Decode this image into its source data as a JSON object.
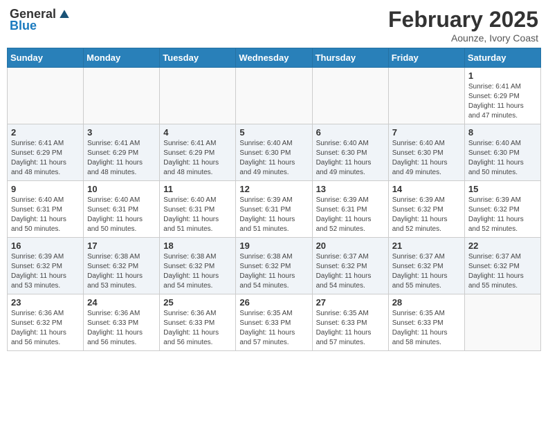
{
  "header": {
    "logo": {
      "general": "General",
      "blue": "Blue"
    },
    "title": "February 2025",
    "location": "Aounze, Ivory Coast"
  },
  "days_of_week": [
    "Sunday",
    "Monday",
    "Tuesday",
    "Wednesday",
    "Thursday",
    "Friday",
    "Saturday"
  ],
  "weeks": [
    {
      "days": [
        {
          "num": "",
          "info": ""
        },
        {
          "num": "",
          "info": ""
        },
        {
          "num": "",
          "info": ""
        },
        {
          "num": "",
          "info": ""
        },
        {
          "num": "",
          "info": ""
        },
        {
          "num": "",
          "info": ""
        },
        {
          "num": "1",
          "info": "Sunrise: 6:41 AM\nSunset: 6:29 PM\nDaylight: 11 hours and 47 minutes."
        }
      ]
    },
    {
      "days": [
        {
          "num": "2",
          "info": "Sunrise: 6:41 AM\nSunset: 6:29 PM\nDaylight: 11 hours and 48 minutes."
        },
        {
          "num": "3",
          "info": "Sunrise: 6:41 AM\nSunset: 6:29 PM\nDaylight: 11 hours and 48 minutes."
        },
        {
          "num": "4",
          "info": "Sunrise: 6:41 AM\nSunset: 6:29 PM\nDaylight: 11 hours and 48 minutes."
        },
        {
          "num": "5",
          "info": "Sunrise: 6:40 AM\nSunset: 6:30 PM\nDaylight: 11 hours and 49 minutes."
        },
        {
          "num": "6",
          "info": "Sunrise: 6:40 AM\nSunset: 6:30 PM\nDaylight: 11 hours and 49 minutes."
        },
        {
          "num": "7",
          "info": "Sunrise: 6:40 AM\nSunset: 6:30 PM\nDaylight: 11 hours and 49 minutes."
        },
        {
          "num": "8",
          "info": "Sunrise: 6:40 AM\nSunset: 6:30 PM\nDaylight: 11 hours and 50 minutes."
        }
      ]
    },
    {
      "days": [
        {
          "num": "9",
          "info": "Sunrise: 6:40 AM\nSunset: 6:31 PM\nDaylight: 11 hours and 50 minutes."
        },
        {
          "num": "10",
          "info": "Sunrise: 6:40 AM\nSunset: 6:31 PM\nDaylight: 11 hours and 50 minutes."
        },
        {
          "num": "11",
          "info": "Sunrise: 6:40 AM\nSunset: 6:31 PM\nDaylight: 11 hours and 51 minutes."
        },
        {
          "num": "12",
          "info": "Sunrise: 6:39 AM\nSunset: 6:31 PM\nDaylight: 11 hours and 51 minutes."
        },
        {
          "num": "13",
          "info": "Sunrise: 6:39 AM\nSunset: 6:31 PM\nDaylight: 11 hours and 52 minutes."
        },
        {
          "num": "14",
          "info": "Sunrise: 6:39 AM\nSunset: 6:32 PM\nDaylight: 11 hours and 52 minutes."
        },
        {
          "num": "15",
          "info": "Sunrise: 6:39 AM\nSunset: 6:32 PM\nDaylight: 11 hours and 52 minutes."
        }
      ]
    },
    {
      "days": [
        {
          "num": "16",
          "info": "Sunrise: 6:39 AM\nSunset: 6:32 PM\nDaylight: 11 hours and 53 minutes."
        },
        {
          "num": "17",
          "info": "Sunrise: 6:38 AM\nSunset: 6:32 PM\nDaylight: 11 hours and 53 minutes."
        },
        {
          "num": "18",
          "info": "Sunrise: 6:38 AM\nSunset: 6:32 PM\nDaylight: 11 hours and 54 minutes."
        },
        {
          "num": "19",
          "info": "Sunrise: 6:38 AM\nSunset: 6:32 PM\nDaylight: 11 hours and 54 minutes."
        },
        {
          "num": "20",
          "info": "Sunrise: 6:37 AM\nSunset: 6:32 PM\nDaylight: 11 hours and 54 minutes."
        },
        {
          "num": "21",
          "info": "Sunrise: 6:37 AM\nSunset: 6:32 PM\nDaylight: 11 hours and 55 minutes."
        },
        {
          "num": "22",
          "info": "Sunrise: 6:37 AM\nSunset: 6:32 PM\nDaylight: 11 hours and 55 minutes."
        }
      ]
    },
    {
      "days": [
        {
          "num": "23",
          "info": "Sunrise: 6:36 AM\nSunset: 6:32 PM\nDaylight: 11 hours and 56 minutes."
        },
        {
          "num": "24",
          "info": "Sunrise: 6:36 AM\nSunset: 6:33 PM\nDaylight: 11 hours and 56 minutes."
        },
        {
          "num": "25",
          "info": "Sunrise: 6:36 AM\nSunset: 6:33 PM\nDaylight: 11 hours and 56 minutes."
        },
        {
          "num": "26",
          "info": "Sunrise: 6:35 AM\nSunset: 6:33 PM\nDaylight: 11 hours and 57 minutes."
        },
        {
          "num": "27",
          "info": "Sunrise: 6:35 AM\nSunset: 6:33 PM\nDaylight: 11 hours and 57 minutes."
        },
        {
          "num": "28",
          "info": "Sunrise: 6:35 AM\nSunset: 6:33 PM\nDaylight: 11 hours and 58 minutes."
        },
        {
          "num": "",
          "info": ""
        }
      ]
    }
  ]
}
